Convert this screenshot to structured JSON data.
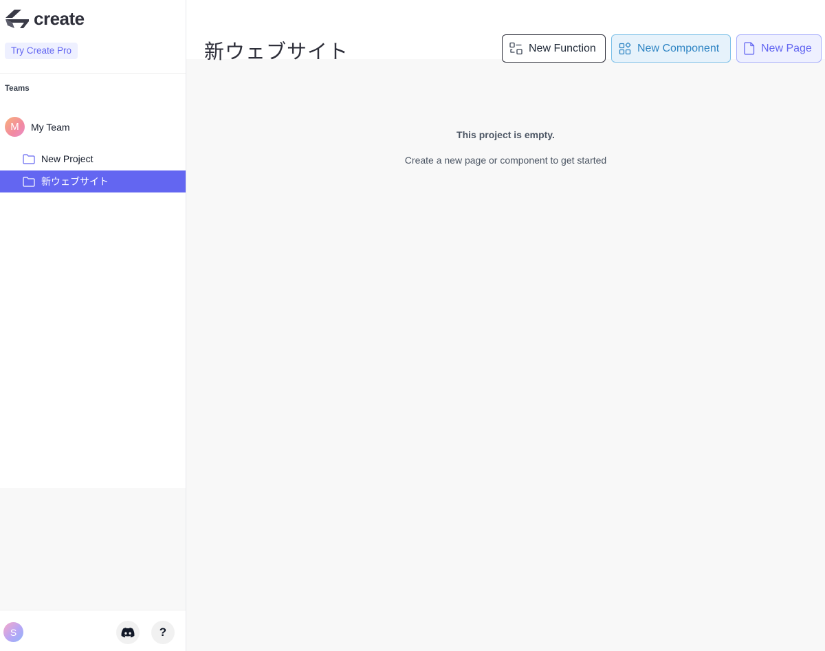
{
  "app": {
    "logo_text": "create",
    "logo_icon": "create-logo-icon"
  },
  "sidebar": {
    "pro_button": "Try Create Pro",
    "teams_label": "Teams",
    "team": {
      "initial": "M",
      "name": "My Team"
    },
    "projects": [
      {
        "label": "New Project",
        "icon": "folder-icon",
        "active": false
      },
      {
        "label": "新ウェブサイト",
        "icon": "folder-icon",
        "active": true
      }
    ],
    "footer": {
      "user_initial": "S",
      "discord_icon": "discord-icon",
      "help_label": "?"
    }
  },
  "main": {
    "title": "新ウェブサイト",
    "toolbar": {
      "new_function": "New Function",
      "new_component": "New Component",
      "new_page": "New Page"
    },
    "empty_state": {
      "title": "This project is empty.",
      "subtitle": "Create a new page or component to get started"
    }
  },
  "colors": {
    "accent": "#6366f1",
    "component_blue": "#2f85c4",
    "text_dark": "#2e2f3a"
  }
}
